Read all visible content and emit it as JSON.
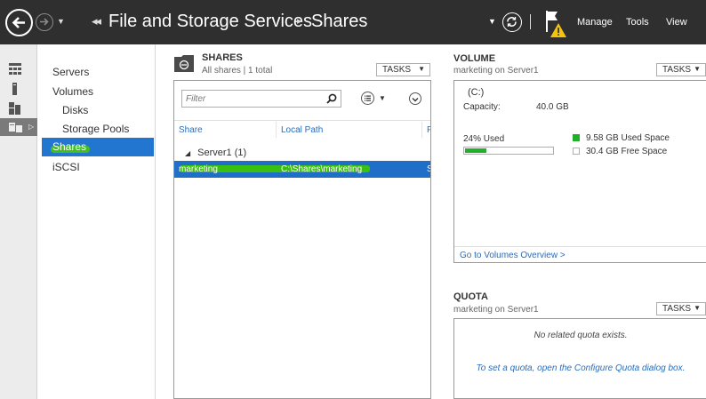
{
  "colors": {
    "titlebar_bg": "#2f2f2f",
    "selection_blue": "#1f6fc8",
    "nav_active_blue": "#2376d0",
    "link_blue": "#2a6cb8",
    "used_space_green": "#22b02a",
    "highlight_green": "#3ac010",
    "warning_yellow": "#f2c511"
  },
  "titlebar": {
    "breadcrumb_parent": "File and Storage Services",
    "breadcrumb_current": "Shares",
    "menu": {
      "manage": "Manage",
      "tools": "Tools",
      "view": "View"
    },
    "icons": [
      "back-icon",
      "forward-icon",
      "refresh-icon",
      "notification-flag-icon",
      "warning-icon"
    ]
  },
  "rail": {
    "icons": [
      "dashboard-icon",
      "local-server-icon",
      "all-servers-icon",
      "file-storage-icon"
    ]
  },
  "sidenav": {
    "items": [
      {
        "label": "Servers"
      },
      {
        "label": "Volumes"
      },
      {
        "label": "Disks"
      },
      {
        "label": "Storage Pools"
      },
      {
        "label": "Shares",
        "selected": true
      },
      {
        "label": "iSCSI"
      }
    ]
  },
  "shares": {
    "title": "SHARES",
    "subtitle": "All shares | 1 total",
    "tasks_label": "TASKS",
    "filter_placeholder": "Filter",
    "columns": [
      "Share",
      "Local Path",
      "P"
    ],
    "group": "Server1 (1)",
    "rows": [
      {
        "share": "marketing",
        "local_path": "C:\\Shares\\marketing",
        "protocol": "S",
        "selected": true
      }
    ]
  },
  "volume": {
    "title": "VOLUME",
    "subtitle": "marketing on Server1",
    "tasks_label": "TASKS",
    "drive": "(C:)",
    "capacity_label": "Capacity:",
    "capacity_value": "40.0 GB",
    "used_percent_label": "24% Used",
    "used_fraction": 0.24,
    "used_space": "9.58 GB Used Space",
    "free_space": "30.4 GB Free Space",
    "overview_link": "Go to Volumes Overview >"
  },
  "quota": {
    "title": "QUOTA",
    "subtitle": "marketing on Server1",
    "tasks_label": "TASKS",
    "empty_message": "No related quota exists.",
    "hint": "To set a quota, open the Configure Quota dialog box."
  }
}
